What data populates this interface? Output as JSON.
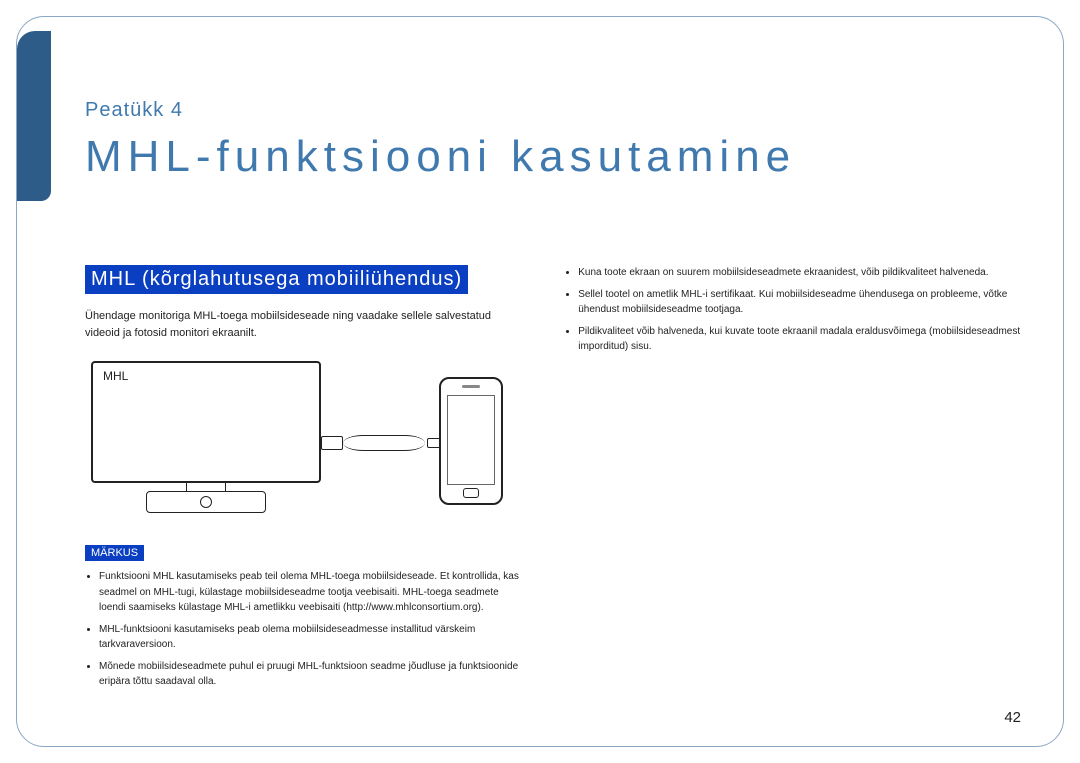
{
  "chapter_label": "Peatükk 4",
  "title": "MHL-funktsiooni kasutamine",
  "section_title": "MHL (kõrglahutusega mobiiliühendus)",
  "intro_text": "Ühendage monitoriga MHL-toega mobiilsideseade ning vaadake sellele salvestatud videoid ja fotosid monitori ekraanilt.",
  "illustration": {
    "mhl_label": "MHL"
  },
  "note_label": "MÄRKUS",
  "left_notes": [
    "Funktsiooni MHL kasutamiseks peab teil olema MHL-toega mobiilsideseade. Et kontrollida, kas seadmel on MHL-tugi, külastage mobiilsideseadme tootja veebisaiti. MHL-toega seadmete loendi saamiseks külastage MHL-i ametlikku veebisaiti (http://www.mhlconsortium.org).",
    "MHL-funktsiooni kasutamiseks peab olema mobiilsideseadmesse installitud värskeim tarkvaraversioon.",
    "Mõnede mobiilsideseadmete puhul ei pruugi MHL-funktsioon seadme jõudluse ja funktsioonide eripära tõttu saadaval olla."
  ],
  "right_notes": [
    "Kuna toote ekraan on suurem mobiilsideseadmete ekraanidest, võib pildikvaliteet halveneda.",
    "Sellel tootel on ametlik MHL-i sertifikaat. Kui mobiilsideseadme ühendusega on probleeme, võtke ühendust mobiilsideseadme tootjaga.",
    "Pildikvaliteet võib halveneda, kui kuvate toote ekraanil madala eraldusvõimega (mobiilsideseadmest imporditud) sisu."
  ],
  "page_number": "42"
}
